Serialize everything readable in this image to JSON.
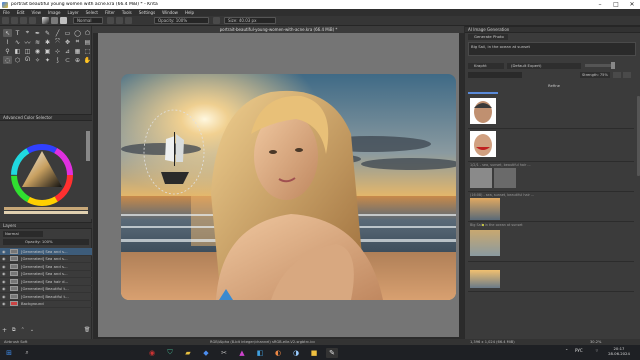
{
  "window": {
    "title": "portrait beautiful young women with acne.kra (66.4 MiB) * - Krita"
  },
  "menu": [
    "File",
    "Edit",
    "View",
    "Image",
    "Layer",
    "Select",
    "Filter",
    "Tools",
    "Settings",
    "Window",
    "Help"
  ],
  "toolbar": {
    "blend_mode": "Normal",
    "opacity": "Opacity: 100%",
    "size": "Size: 40.03 px"
  },
  "document": {
    "tab_title": "portrait-beautiful-young-women-with-acne.kra (66.4 MiB) *"
  },
  "left_panel": {
    "color_selector_title": "Advanced Color Selector",
    "layers_title": "Layers",
    "blend": "Normal",
    "opacity": "Opacity: 100%",
    "layers": [
      "[Generated] Sea and s...",
      "[Generated] Sea and s...",
      "[Generated] Sea and s...",
      "[Generated] Sea and s...",
      "[Generated] Sea hair d...",
      "[Generated] Beautiful t...",
      "[Generated] Beautiful t...",
      "Background"
    ],
    "bottom_label": "Airbrush Soft"
  },
  "right_panel": {
    "title": "AI Image Generation",
    "tab": "Generate Photo",
    "prompt": "Big Sail, in the ocean at sunset",
    "model": "Krapht",
    "style": "(Default Expert)",
    "strength": "Strength: 75%",
    "refine_label": "Refine",
    "history_labels": [
      "1/2/1 - sea, sunset, beautiful hair ...",
      "(16:08) - sea, sunset, beautiful hair ...",
      "Big Sail, in the ocean at sunset"
    ]
  },
  "status": {
    "left": "Airbrush Soft",
    "center": "RGB/Alpha (8-bit integer/channel)  sRGB-elle-V2-srgbtrc.icc",
    "size": "1,396 x 1,024 (66.4 MiB)",
    "zoom": "30.2%"
  },
  "taskbar": {
    "time": "20:17",
    "date": "28.06.2024",
    "lang": "РУС"
  },
  "colors": {
    "accent": "#3d5c7a",
    "titlebar": "#ffffff",
    "canvas": "#757575"
  }
}
